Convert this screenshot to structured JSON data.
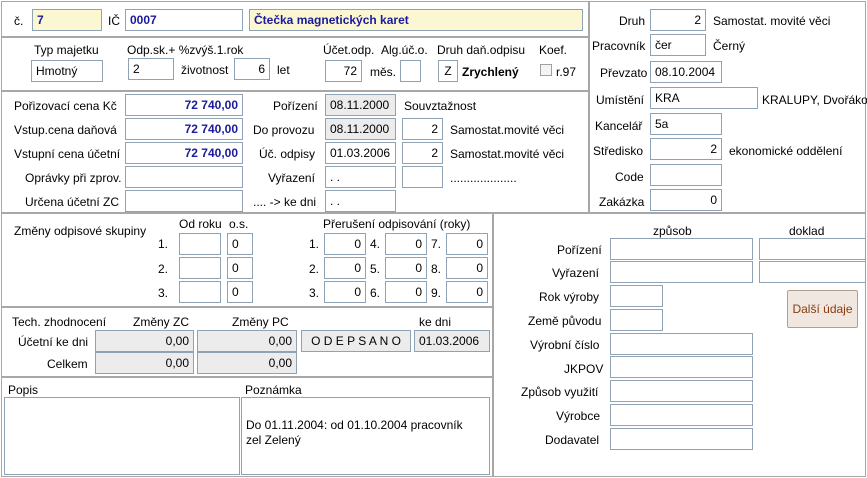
{
  "header": {
    "c_label": "č.",
    "c_value": "7",
    "ic_label": "IČ",
    "ic_value": "0007",
    "name_value": "Čtečka magnetických karet"
  },
  "row2": {
    "typ_label": "Typ majetku",
    "typ_value": "Hmotný",
    "odp_label": "Odp.sk.+ %zvýš.1.rok",
    "odp_value": "2",
    "zivotnost_label": "životnost",
    "zivotnost_value": "6",
    "let_label": "let",
    "ucet_label": "Účet.odp.",
    "ucet_value": "72",
    "mes_label": "měs.",
    "alg_label": "Alg.úč.o.",
    "alg_value": "",
    "druh_label": "Druh daň.odpisu",
    "druh_code": "Z",
    "druh_text": "Zrychlený",
    "koef_label": "Koef.",
    "koef_check_label": "r.97"
  },
  "prices": {
    "poriz_label": "Pořizovací cena Kč",
    "poriz_value": "72 740,00",
    "vstup_dan_label": "Vstup.cena daňová",
    "vstup_dan_value": "72 740,00",
    "vstup_uc_label": "Vstupní cena účetní",
    "vstup_uc_value": "72 740,00",
    "opravky_label": "Oprávky při zprov.",
    "opravky_value": "",
    "urcena_label": "Určena účetní ZC",
    "urcena_value": ""
  },
  "dates": {
    "porizeni_label": "Pořízení",
    "porizeni_value": "08.11.2000",
    "provoz_label": "Do provozu",
    "provoz_value": "08.11.2000",
    "uc_odpisy_label": "Úč. odpisy",
    "uc_odpisy_value": "01.03.2006",
    "vyrazeni_label": "Vyřazení",
    "vyrazeni_value": ". .",
    "kedni_label": ".... -> ke dni",
    "kedni_value": ". .",
    "souv_label": "Souvztažnost",
    "souv1_num": "2",
    "souv1_text": "Samostat.movité věci",
    "souv2_num": "2",
    "souv2_text": "Samostat.movité věci",
    "souv3_num": "",
    "souv3_text": "...................."
  },
  "right": {
    "druh_label": "Druh",
    "druh_num": "2",
    "druh_text": "Samostat. movité věci",
    "pracovnik_label": "Pracovník",
    "pracovnik_code": "čer",
    "pracovnik_name": "Černý",
    "prevzato_label": "Převzato",
    "prevzato_value": "08.10.2004",
    "umisteni_label": "Umístění",
    "umisteni_code": "KRA",
    "umisteni_text": "KRALUPY, Dvořákova",
    "kancelar_label": "Kancelář",
    "kancelar_value": "5a",
    "stredisko_label": "Středisko",
    "stredisko_num": "2",
    "stredisko_text": "ekonomické oddělení",
    "code_label": "Code",
    "code_value": "",
    "zakazka_label": "Zakázka",
    "zakazka_value": "0"
  },
  "zmeny": {
    "title": "Změny odpisové skupiny",
    "od_roku_label": "Od roku",
    "os_label": "o.s.",
    "rows": [
      {
        "n": "1.",
        "rok": "",
        "os": "0"
      },
      {
        "n": "2.",
        "rok": "",
        "os": "0"
      },
      {
        "n": "3.",
        "rok": "",
        "os": "0"
      }
    ]
  },
  "preruseni": {
    "title": "Přerušení odpisování (roky)",
    "items": [
      {
        "n": "1.",
        "v": "0"
      },
      {
        "n": "4.",
        "v": "0"
      },
      {
        "n": "7.",
        "v": "0"
      },
      {
        "n": "2.",
        "v": "0"
      },
      {
        "n": "5.",
        "v": "0"
      },
      {
        "n": "8.",
        "v": "0"
      },
      {
        "n": "3.",
        "v": "0"
      },
      {
        "n": "6.",
        "v": "0"
      },
      {
        "n": "9.",
        "v": "0"
      }
    ]
  },
  "tech": {
    "title": "Tech. zhodnocení",
    "zmeny_zc_label": "Změny ZC",
    "zmeny_pc_label": "Změny PC",
    "ke_dni_label": "ke dni",
    "ucetni_label": "Účetní ke dni",
    "ucetni_zc": "0,00",
    "ucetni_pc": "0,00",
    "odepsano": "O D E P S A N O",
    "ke_dni_value": "01.03.2006",
    "celkem_label": "Celkem",
    "celkem_zc": "0,00",
    "celkem_pc": "0,00"
  },
  "notes": {
    "popis_label": "Popis",
    "popis_value": "",
    "poznamka_label": "Poznámka",
    "poznamka_value": "Do 01.11.2004: od 01.10.2004 pracovník zel  Zelený"
  },
  "extra": {
    "zpusob_label": "způsob",
    "doklad_label": "doklad",
    "porizeni_label": "Pořízení",
    "vyrazeni_label": "Vyřazení",
    "rok_vyroby_label": "Rok výroby",
    "zeme_label": "Země původu",
    "vyrobni_label": "Výrobní číslo",
    "jkpov_label": "JKPOV",
    "zpusob_vyuziti_label": "Způsob využití",
    "vyrobce_label": "Výrobce",
    "dodavatel_label": "Dodavatel",
    "dalsi_button": "Další údaje"
  },
  "colors": {
    "border": "#a7a7a7",
    "input_border": "#8fa3b4",
    "highlight_yellow": "#fbf7d2",
    "value_blue": "#1a1a9c"
  }
}
